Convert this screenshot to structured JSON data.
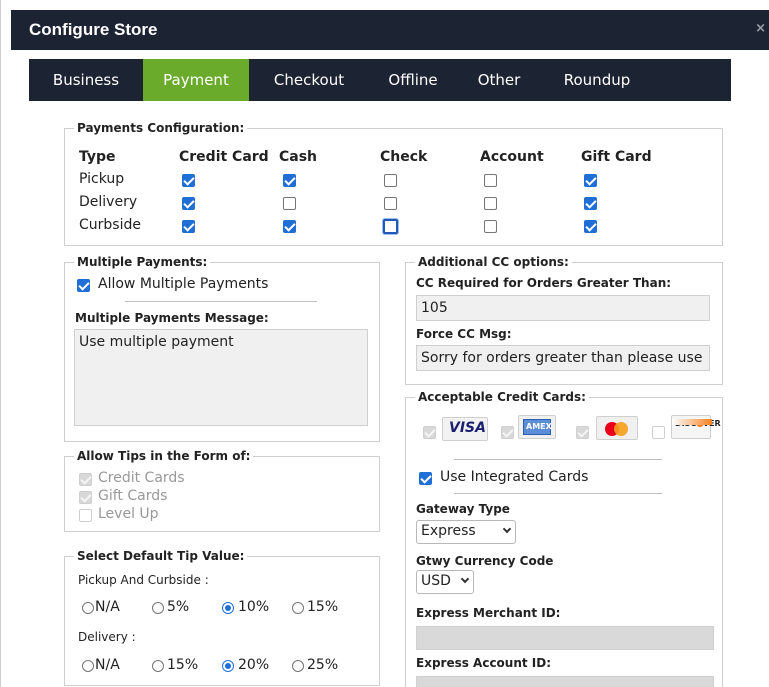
{
  "window": {
    "title": "Configure Store",
    "close_glyph": "×"
  },
  "tabs": [
    "Business",
    "Payment",
    "Checkout",
    "Offline",
    "Other",
    "Roundup"
  ],
  "active_tab": "Payment",
  "payments_config": {
    "legend": "Payments Configuration:",
    "headers": [
      "Type",
      "Credit Card",
      "Cash",
      "Check",
      "Account",
      "Gift Card"
    ],
    "rows": [
      {
        "type": "Pickup",
        "values": [
          true,
          true,
          false,
          false,
          true
        ]
      },
      {
        "type": "Delivery",
        "values": [
          true,
          false,
          false,
          false,
          true
        ]
      },
      {
        "type": "Curbside",
        "values": [
          true,
          true,
          false,
          false,
          true
        ]
      }
    ]
  },
  "multiple_payments": {
    "legend": "Multiple Payments:",
    "allow_label": "Allow Multiple Payments",
    "allow_checked": true,
    "message_label": "Multiple Payments Message:",
    "message_value": "Use multiple payment"
  },
  "tips": {
    "legend": "Allow Tips in the Form of:",
    "options": [
      {
        "label": "Credit Cards",
        "checked": true
      },
      {
        "label": "Gift Cards",
        "checked": true
      },
      {
        "label": "Level Up",
        "checked": false
      }
    ]
  },
  "default_tip": {
    "legend": "Select Default Tip Value:",
    "pickup_label": "Pickup And Curbside :",
    "pickup_options": [
      "N/A",
      "5%",
      "10%",
      "15%"
    ],
    "pickup_selected": "10%",
    "delivery_label": "Delivery :",
    "delivery_options": [
      "N/A",
      "15%",
      "20%",
      "25%"
    ],
    "delivery_selected": "20%"
  },
  "additional_cc": {
    "legend": "Additional CC options:",
    "required_label": "CC Required for Orders Greater Than:",
    "required_value": "105",
    "force_label": "Force CC Msg:",
    "force_value": "Sorry for orders greater than please use"
  },
  "acceptable_cards": {
    "legend": "Acceptable Credit Cards:",
    "cards": [
      {
        "name": "VISA",
        "checked": true
      },
      {
        "name": "AMEX",
        "checked": true
      },
      {
        "name": "MasterCard",
        "checked": true
      },
      {
        "name": "DISCOVER",
        "checked": false
      }
    ],
    "integrated_label": "Use Integrated Cards",
    "integrated_checked": true,
    "gateway_label": "Gateway Type",
    "gateway_value": "Express",
    "currency_label": "Gtwy Currency Code",
    "currency_value": "USD",
    "merchant_label": "Express Merchant ID:",
    "merchant_value": "",
    "account_label": "Express Account ID:",
    "account_value": ""
  }
}
